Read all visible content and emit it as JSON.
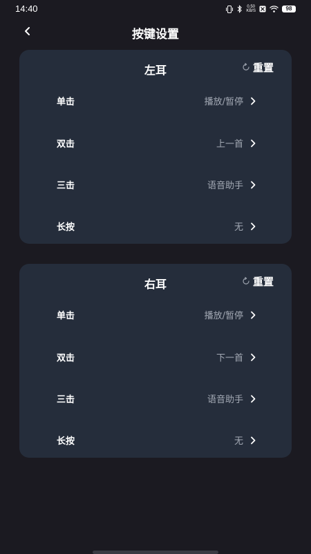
{
  "status_bar": {
    "time": "14:40",
    "net_speed_value": "0.50",
    "net_speed_unit": "KB/S",
    "battery": "98"
  },
  "header": {
    "title": "按键设置"
  },
  "left_ear": {
    "title": "左耳",
    "reset_label": "重置",
    "rows": [
      {
        "label": "单击",
        "value": "播放/暂停"
      },
      {
        "label": "双击",
        "value": "上一首"
      },
      {
        "label": "三击",
        "value": "语音助手"
      },
      {
        "label": "长按",
        "value": "无"
      }
    ]
  },
  "right_ear": {
    "title": "右耳",
    "reset_label": "重置",
    "rows": [
      {
        "label": "单击",
        "value": "播放/暂停"
      },
      {
        "label": "双击",
        "value": "下一首"
      },
      {
        "label": "三击",
        "value": "语音助手"
      },
      {
        "label": "长按",
        "value": "无"
      }
    ]
  },
  "colors": {
    "background": "#1b1a21",
    "card": "#252d3b",
    "secondary_text": "#a3a9b4"
  },
  "icons": {
    "back": "chevron-left-icon",
    "reset": "refresh-icon",
    "row_arrow": "chevron-right-icon"
  }
}
